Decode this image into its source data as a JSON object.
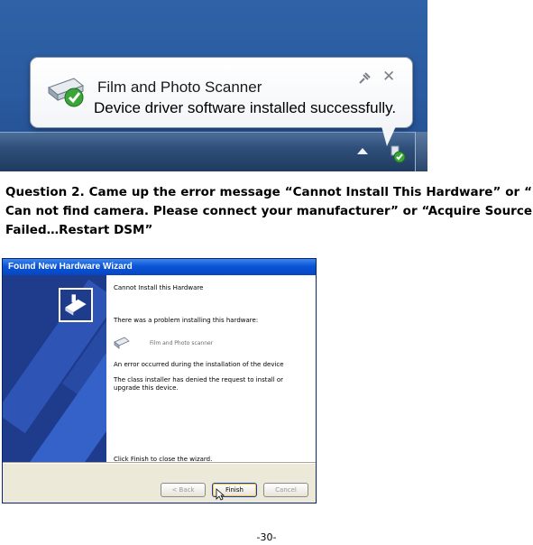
{
  "balloon": {
    "title": "Film and Photo Scanner",
    "message": "Device driver software installed successfully.",
    "close_glyph": "✕",
    "icon": "scanner-check-icon"
  },
  "question": {
    "text": "Question 2. Came up the error message “Cannot Install This Hardware” or “ Can not find camera. Please connect your manufacturer” or “Acquire Source Failed…Restart DSM”"
  },
  "wizard": {
    "title": "Found New Hardware Wizard",
    "heading": "Cannot Install this Hardware",
    "problem_line": "There was a problem installing this hardware:",
    "device_name": "Film and Photo scanner",
    "error_line": "An error occurred during the installation of the device",
    "denied_line1": "The class installer has denied the request to install or",
    "denied_line2": "upgrade this device.",
    "finish_hint": "Click Finish to close the wizard.",
    "buttons": {
      "back": "< Back",
      "finish": "Finish",
      "cancel": "Cancel"
    }
  },
  "page_number": "-30-"
}
